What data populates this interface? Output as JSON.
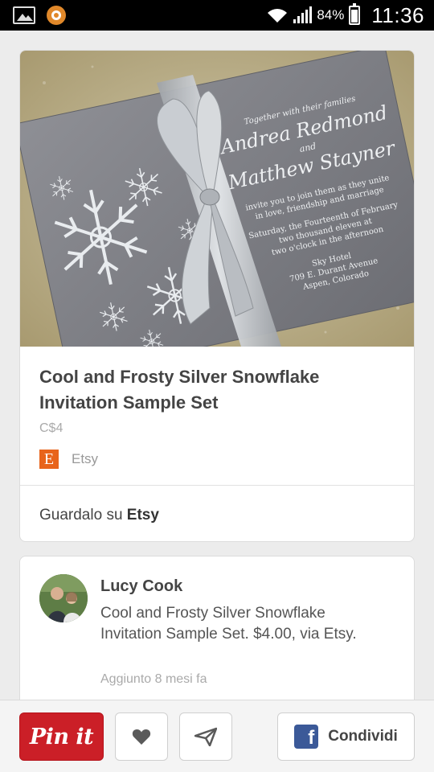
{
  "status_bar": {
    "battery": "84%",
    "time": "11:36"
  },
  "pin": {
    "title": "Cool and Frosty Silver Snowflake Invitation Sample Set",
    "price": "C$4",
    "source_logo_letter": "E",
    "source_name": "Etsy",
    "view_on_prefix": "Guardalo su",
    "view_on_site": "Etsy"
  },
  "invitation": {
    "line1": "Together with their families",
    "name1": "Andrea Redmond",
    "and": "and",
    "name2": "Matthew Stayner",
    "line2": "invite you to join them as they unite",
    "line3": "in love, friendship and marriage",
    "line4": "Saturday, the Fourteenth of February",
    "line5": "two thousand eleven at",
    "line6": "two o'clock in the afternoon",
    "line7": "Sky Hotel",
    "line8": "709 E. Durant Avenue",
    "line9": "Aspen, Colorado"
  },
  "comment": {
    "user_name": "Lucy Cook",
    "text": "Cool and Frosty Silver Snowflake Invitation Sample Set. $4.00, via Etsy.",
    "added": "Aggiunto 8 mesi fa"
  },
  "actions": {
    "pin_label": "Pin it",
    "fb_letter": "f",
    "share_label": "Condividi"
  },
  "colors": {
    "pin_red": "#cb1f27",
    "etsy_orange": "#e8641b",
    "facebook_blue": "#3b5998"
  }
}
